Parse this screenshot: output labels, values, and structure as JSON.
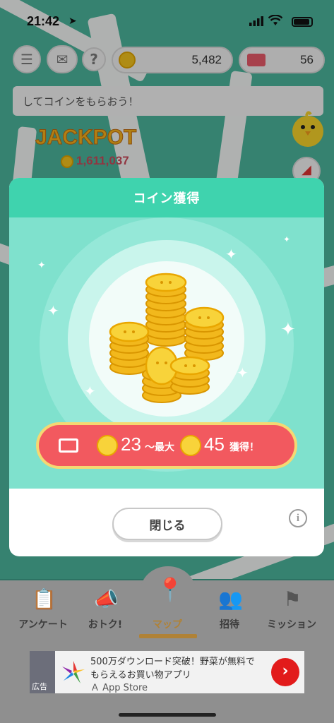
{
  "status": {
    "time": "21:42"
  },
  "topbar": {
    "coins": "5,482",
    "tickets": "56",
    "help_label": "?"
  },
  "banner": {
    "text": "してコインをもらおう！"
  },
  "jackpot": {
    "title": "JACKPOT",
    "value": "1,611,037"
  },
  "modal": {
    "title": "コイン獲得",
    "reward": {
      "min": "23",
      "range_label": "〜最大",
      "max": "45",
      "suffix": "獲得！"
    },
    "close_label": "閉じる",
    "info_label": "i"
  },
  "nav": {
    "items": [
      {
        "label": "アンケート",
        "icon": "clipboard-icon"
      },
      {
        "label": "おトク!",
        "icon": "megaphone-icon"
      },
      {
        "label": "マップ",
        "icon": "map-pin-icon"
      },
      {
        "label": "招待",
        "icon": "people-icon"
      },
      {
        "label": "ミッション",
        "icon": "flag-icon"
      }
    ],
    "active": "マップ"
  },
  "ad": {
    "badge": "広告",
    "line1": "500万ダウンロード突破！野菜が無料で",
    "line2": "もらえるお買い物アプリ",
    "store": "App Store"
  },
  "colors": {
    "accent": "#3fd3ae",
    "reward": "#f2595f",
    "active_nav": "#b08236"
  }
}
